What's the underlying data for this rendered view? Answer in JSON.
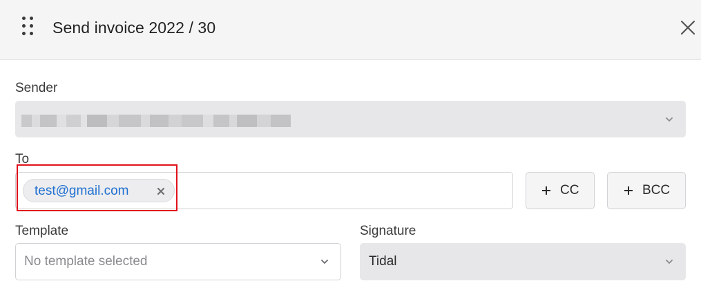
{
  "header": {
    "title": "Send invoice 2022 / 30"
  },
  "form": {
    "sender": {
      "label": "Sender"
    },
    "to": {
      "label": "To",
      "recipients": [
        "test@gmail.com"
      ],
      "cc_label": "CC",
      "bcc_label": "BCC"
    },
    "template": {
      "label": "Template",
      "value": "No template selected"
    },
    "signature": {
      "label": "Signature",
      "value": "Tidal"
    }
  },
  "icons": {
    "drag": "drag-handle-icon",
    "close": "close-icon",
    "chevron": "chevron-down-icon",
    "remove": "remove-chip-icon",
    "plus": "plus-icon"
  },
  "colors": {
    "chip_text": "#1f6fd1",
    "highlight": "#e0111b",
    "disabled_bg": "#e7e7e9",
    "header_bg": "#f5f5f6"
  }
}
